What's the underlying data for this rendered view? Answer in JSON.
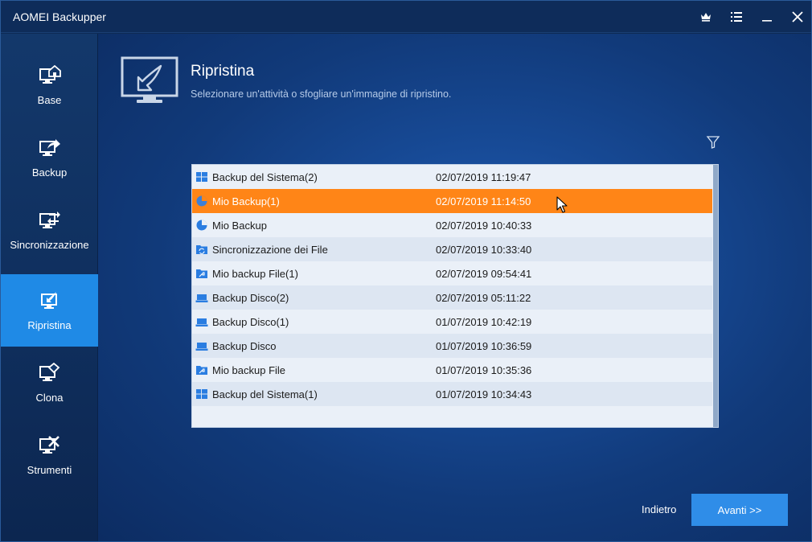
{
  "app": {
    "title": "AOMEI Backupper"
  },
  "titlebar": {
    "buttons": [
      {
        "icon": "crown-icon"
      },
      {
        "icon": "menu-icon"
      },
      {
        "icon": "minimize-icon"
      },
      {
        "icon": "close-icon"
      }
    ]
  },
  "sidebar": {
    "items": [
      {
        "label": "Base",
        "icon": "home-monitor-icon",
        "active": false
      },
      {
        "label": "Backup",
        "icon": "backup-monitor-icon",
        "active": false
      },
      {
        "label": "Sincronizzazione",
        "icon": "sync-monitor-icon",
        "active": false
      },
      {
        "label": "Ripristina",
        "icon": "restore-monitor-icon",
        "active": true
      },
      {
        "label": "Clona",
        "icon": "clone-monitor-icon",
        "active": false
      },
      {
        "label": "Strumenti",
        "icon": "tools-monitor-icon",
        "active": false
      }
    ]
  },
  "header": {
    "title": "Ripristina",
    "subtitle": "Selezionare un'attività o sfogliare un'immagine di ripristino."
  },
  "list": {
    "rows": [
      {
        "type": "system",
        "name": "Backup del Sistema(2)",
        "date": "02/07/2019 11:19:47",
        "selected": false
      },
      {
        "type": "partition",
        "name": "Mio Backup(1)",
        "date": "02/07/2019 11:14:50",
        "selected": true
      },
      {
        "type": "partition",
        "name": "Mio Backup",
        "date": "02/07/2019 10:40:33",
        "selected": false
      },
      {
        "type": "sync",
        "name": "Sincronizzazione dei File",
        "date": "02/07/2019 10:33:40",
        "selected": false
      },
      {
        "type": "file",
        "name": "Mio backup File(1)",
        "date": "02/07/2019 09:54:41",
        "selected": false
      },
      {
        "type": "disk",
        "name": "Backup Disco(2)",
        "date": "02/07/2019 05:11:22",
        "selected": false
      },
      {
        "type": "disk",
        "name": "Backup Disco(1)",
        "date": "01/07/2019 10:42:19",
        "selected": false
      },
      {
        "type": "disk",
        "name": "Backup Disco",
        "date": "01/07/2019 10:36:59",
        "selected": false
      },
      {
        "type": "file",
        "name": "Mio backup File",
        "date": "01/07/2019 10:35:36",
        "selected": false
      },
      {
        "type": "system",
        "name": "Backup del Sistema(1)",
        "date": "01/07/2019 10:34:43",
        "selected": false
      }
    ]
  },
  "footer": {
    "back_label": "Indietro",
    "next_label": "Avanti >>"
  },
  "colors": {
    "accent": "#1f8ae6",
    "selection": "#ff8517",
    "next_button": "#2f8de8",
    "icon_blue": "#2a7de1"
  }
}
